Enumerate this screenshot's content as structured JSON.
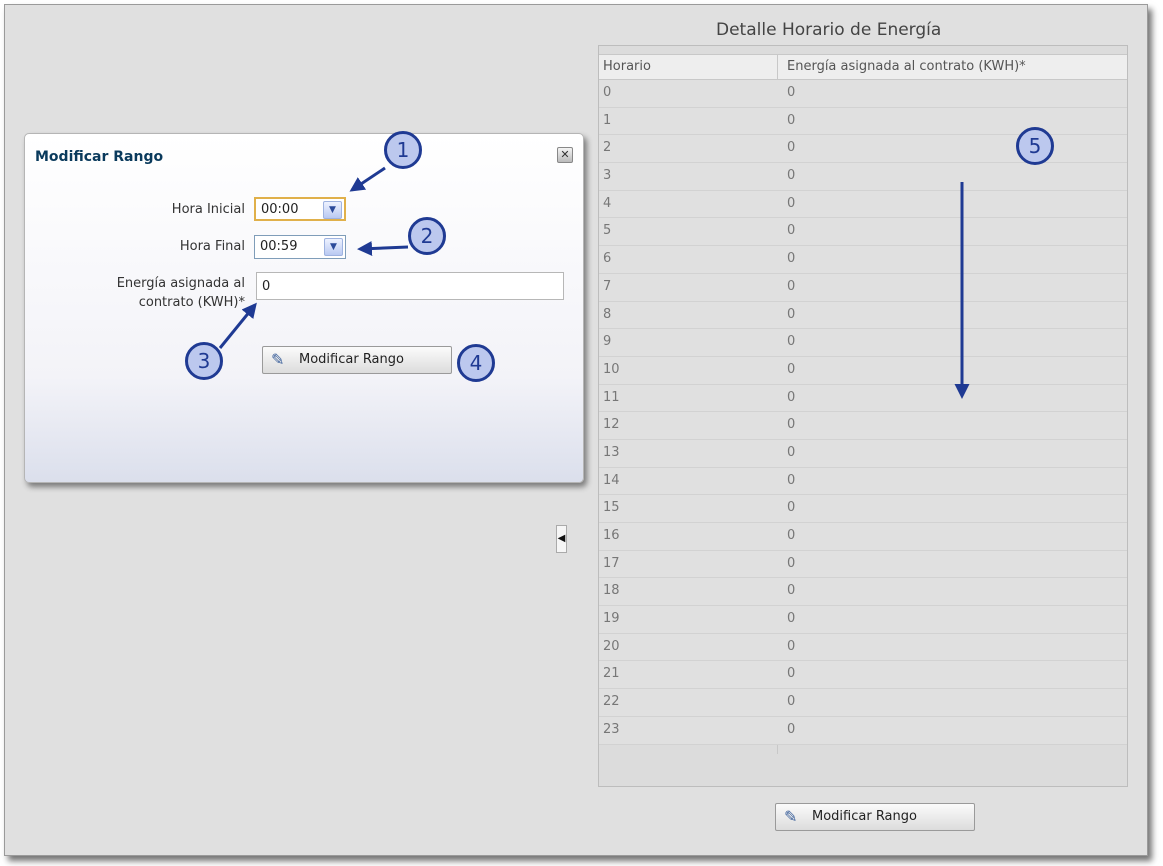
{
  "detail_panel": {
    "title": "Detalle Horario de Energía",
    "columns": [
      "Horario",
      "Energía asignada al contrato (KWH)*"
    ],
    "rows": [
      [
        "0",
        "0"
      ],
      [
        "1",
        "0"
      ],
      [
        "2",
        "0"
      ],
      [
        "3",
        "0"
      ],
      [
        "4",
        "0"
      ],
      [
        "5",
        "0"
      ],
      [
        "6",
        "0"
      ],
      [
        "7",
        "0"
      ],
      [
        "8",
        "0"
      ],
      [
        "9",
        "0"
      ],
      [
        "10",
        "0"
      ],
      [
        "11",
        "0"
      ],
      [
        "12",
        "0"
      ],
      [
        "13",
        "0"
      ],
      [
        "14",
        "0"
      ],
      [
        "15",
        "0"
      ],
      [
        "16",
        "0"
      ],
      [
        "17",
        "0"
      ],
      [
        "18",
        "0"
      ],
      [
        "19",
        "0"
      ],
      [
        "20",
        "0"
      ],
      [
        "21",
        "0"
      ],
      [
        "22",
        "0"
      ],
      [
        "23",
        "0"
      ]
    ],
    "button_label": "Modificar Rango"
  },
  "dialog": {
    "title": "Modificar Rango",
    "close_icon": "close-icon",
    "start_label": "Hora Inicial",
    "start_value": "00:00",
    "end_label": "Hora Final",
    "end_value": "00:59",
    "energy_label_line1": "Energía asignada al",
    "energy_label_line2": "contrato (KWH)*",
    "energy_value": "0",
    "button_label": "Modificar Rango"
  },
  "callouts": [
    "1",
    "2",
    "3",
    "4",
    "5"
  ],
  "icons": {
    "button": "pencil-icon",
    "dropdown": "chevron-down-icon",
    "splitter": "collapse-left-icon"
  },
  "colors": {
    "callout_fill": "#bcc8ee",
    "callout_stroke": "#1f3a93",
    "dialog_title": "#0a3a5c",
    "focus_border": "#e0b04a"
  }
}
